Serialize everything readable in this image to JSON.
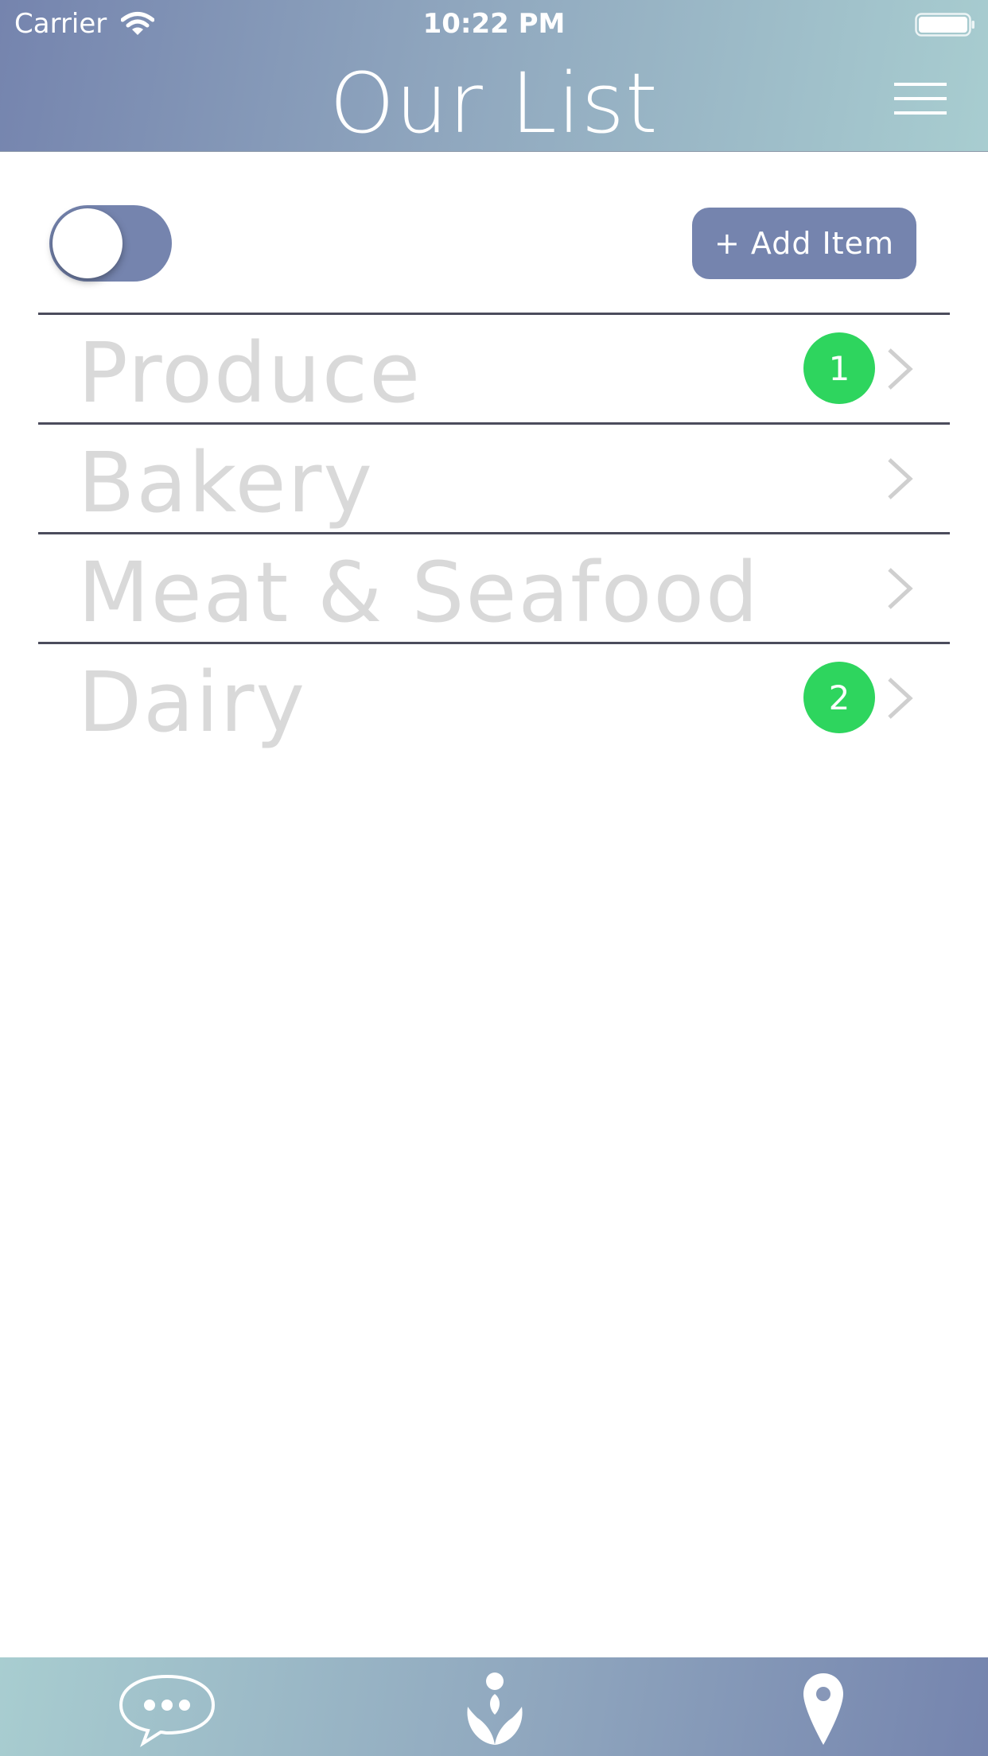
{
  "status_bar": {
    "carrier": "Carrier",
    "time": "10:22 PM"
  },
  "header": {
    "title": "Our List",
    "menu_icon": "hamburger-menu-icon"
  },
  "controls": {
    "toggle_on": false,
    "add_button_label": "+ Add Item"
  },
  "categories": [
    {
      "label": "Produce",
      "badge": "1"
    },
    {
      "label": "Bakery",
      "badge": ""
    },
    {
      "label": "Meat & Seafood",
      "badge": ""
    },
    {
      "label": "Dairy",
      "badge": "2"
    }
  ],
  "tabbar": {
    "items": [
      "chat-bubble-icon",
      "person-lotus-icon",
      "location-pin-icon"
    ]
  },
  "colors": {
    "accent": "#7584ae",
    "badge": "#2ed55e",
    "header_gradient_start": "#7584ae",
    "header_gradient_end": "#a8cdd0",
    "label": "#d9d9d9"
  }
}
